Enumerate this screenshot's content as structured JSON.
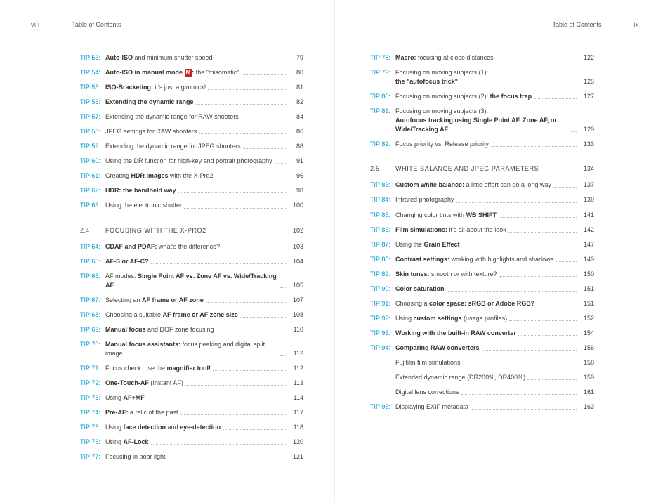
{
  "left": {
    "pageNum": "viii",
    "header": "Table of Contents",
    "entries": [
      {
        "tip": "TIP 53:",
        "html": "<b>Auto-ISO</b> and minimum shutter speed",
        "pg": "79"
      },
      {
        "tip": "TIP 54:",
        "html": "<b>Auto-ISO in manual mode <span class='m-badge'>M</span>:</b> the \"misomatic\"",
        "pg": "80"
      },
      {
        "tip": "TIP 55:",
        "html": "<b>ISO-Bracketing:</b> it's just a gimmick!",
        "pg": "81"
      },
      {
        "tip": "TIP 56:",
        "html": "<b>Extending the dynamic range</b>",
        "pg": "82"
      },
      {
        "tip": "TIP 57:",
        "html": "Extending the dynamic range for RAW shooters",
        "pg": "84"
      },
      {
        "tip": "TIP 58:",
        "html": "JPEG settings for RAW shooters",
        "pg": "86"
      },
      {
        "tip": "TIP 59:",
        "html": "Extending the dynamic range for JPEG shooters",
        "pg": "88"
      },
      {
        "tip": "TIP 60:",
        "html": "Using the DR function for high-key and portrait photography",
        "pg": "91"
      },
      {
        "tip": "TIP 61:",
        "html": "Creating <b>HDR images</b> with the X-Pro2",
        "pg": "96"
      },
      {
        "tip": "TIP 62:",
        "html": "<b>HDR: the handheld way</b>",
        "pg": "98"
      },
      {
        "tip": "TIP 63:",
        "html": "Using the electronic shutter",
        "pg": "100"
      },
      {
        "section": "2.4",
        "html": "FOCUSING WITH THE X-PRO2",
        "pg": "102"
      },
      {
        "tip": "TIP 64:",
        "html": "<b>CDAF and PDAF:</b> what's the difference?",
        "pg": "103"
      },
      {
        "tip": "TIP 65:",
        "html": "<b>AF-S or AF-C?</b>",
        "pg": "104"
      },
      {
        "tip": "TIP 66:",
        "html": "AF modes: <b>Single Point AF vs. Zone AF vs. Wide/Tracking AF</b>",
        "pg": "105"
      },
      {
        "tip": "TIP 67:",
        "html": "Selecting an <b>AF frame or AF zone</b>",
        "pg": "107"
      },
      {
        "tip": "TIP 68:",
        "html": "Choosing a suitable <b>AF frame or AF zone size</b>",
        "pg": "108"
      },
      {
        "tip": "TIP 69:",
        "html": "<b>Manual focus</b> and DOF zone focusing",
        "pg": "110"
      },
      {
        "tip": "TIP 70:",
        "html": "<b>Manual focus assistants:</b> focus peaking and digital split image",
        "pg": "112"
      },
      {
        "tip": "TIP 71:",
        "html": "Focus check: use the <b>magnifier tool!</b>",
        "pg": "112"
      },
      {
        "tip": "TIP 72:",
        "html": "<b>One-Touch-AF</b> (Instant AF)",
        "pg": "113"
      },
      {
        "tip": "TIP 73:",
        "html": "Using <b>AF+MF</b>",
        "pg": "114"
      },
      {
        "tip": "TIP 74:",
        "html": "<b>Pre-AF:</b> a relic of the past",
        "pg": "117"
      },
      {
        "tip": "TIP 75:",
        "html": "Using <b>face detection</b> and <b>eye-detection</b>",
        "pg": "118"
      },
      {
        "tip": "TIP 76:",
        "html": "Using <b>AF-Lock</b>",
        "pg": "120"
      },
      {
        "tip": "TIP 77:",
        "html": "Focusing in poor light",
        "pg": "121"
      }
    ]
  },
  "right": {
    "pageNum": "ix",
    "header": "Table of Contents",
    "entries": [
      {
        "tip": "TIP 78:",
        "html": "<b>Macro:</b> focusing at close distances",
        "pg": "122"
      },
      {
        "tip": "TIP 79:",
        "html": "Focusing on moving subjects (1):<br><b>the \"autofocus trick\"</b>",
        "pg": "125"
      },
      {
        "tip": "TIP 80:",
        "html": "Focusing on moving subjects (2): <b>the focus trap</b>",
        "pg": "127"
      },
      {
        "tip": "TIP 81:",
        "html": "Focusing on moving subjects (3):<br><b>Autofocus tracking using Single Point AF, Zone AF, or Wide/Tracking AF</b>",
        "pg": "129"
      },
      {
        "tip": "TIP 82:",
        "html": "Focus priority vs. Release priority",
        "pg": "133"
      },
      {
        "section": "2.5",
        "html": "WHITE BALANCE AND JPEG PARAMETERS",
        "pg": "134"
      },
      {
        "tip": "TIP 83:",
        "html": "<b>Custom white balance:</b> a little effort can go a long way",
        "pg": "137"
      },
      {
        "tip": "TIP 84:",
        "html": "Infrared photography",
        "pg": "139"
      },
      {
        "tip": "TIP 85:",
        "html": "Changing color tints with <b>WB SHIFT</b>",
        "pg": "141"
      },
      {
        "tip": "TIP 86:",
        "html": "<b>Film simulations:</b> it's all about the look",
        "pg": "142"
      },
      {
        "tip": "TIP 87:",
        "html": "Using the <b>Grain Effect</b>",
        "pg": "147"
      },
      {
        "tip": "TIP 88:",
        "html": "<b>Contrast settings:</b> working with highlights and shadows",
        "pg": "149"
      },
      {
        "tip": "TIP 89:",
        "html": "<b>Skin tones:</b> smooth or with texture?",
        "pg": "150"
      },
      {
        "tip": "TIP 90:",
        "html": "<b>Color saturation</b>",
        "pg": "151"
      },
      {
        "tip": "TIP 91:",
        "html": "Choosing a <b>color space: sRGB or Adobe RGB?</b>",
        "pg": "151"
      },
      {
        "tip": "TIP 92:",
        "html": "Using <b>custom settings</b> (usage profiles)",
        "pg": "152"
      },
      {
        "tip": "TIP 93:",
        "html": "<b>Working with the built-in RAW converter</b>",
        "pg": "154"
      },
      {
        "tip": "TIP 94:",
        "html": "<b>Comparing RAW converters</b>",
        "pg": "156"
      },
      {
        "noTip": true,
        "html": "Fujifilm film simulations",
        "pg": "158"
      },
      {
        "noTip": true,
        "html": "Extended dynamic range (DR200%, DR400%)",
        "pg": "159"
      },
      {
        "noTip": true,
        "html": "Digital lens corrections",
        "pg": "161"
      },
      {
        "tip": "TIP 95:",
        "html": "Displaying EXIF metadata",
        "pg": "163"
      }
    ]
  }
}
